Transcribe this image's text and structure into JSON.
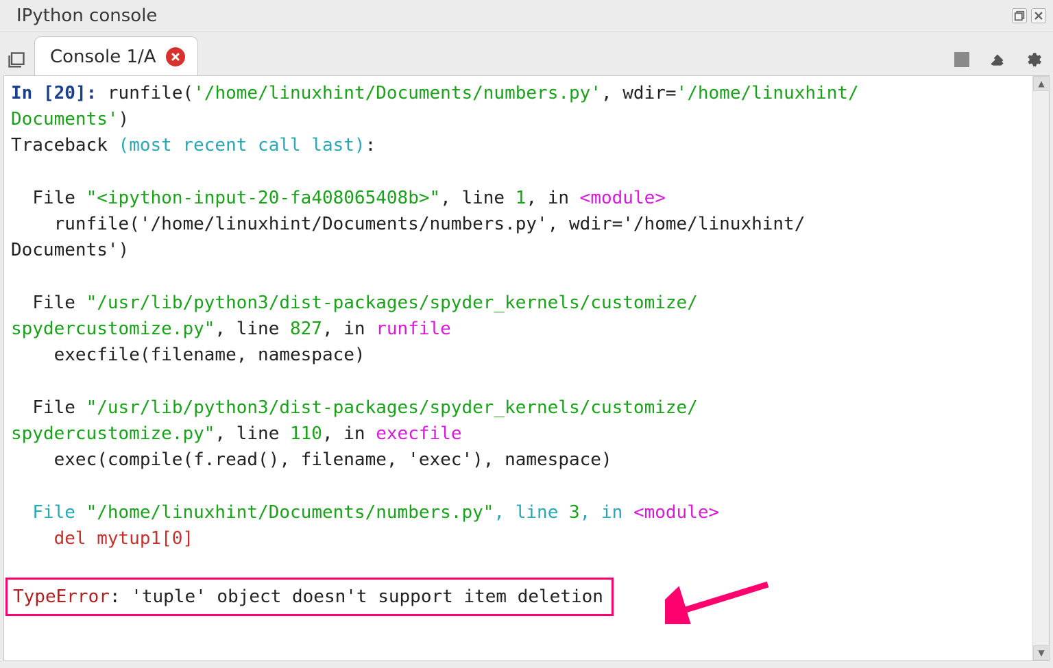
{
  "panel_title": "IPython console",
  "tab": {
    "label": "Console 1/A"
  },
  "prompt": {
    "label": "In",
    "count": "20"
  },
  "cmd": {
    "fn": "runfile",
    "arg_path": "'/home/linuxhint/Documents/numbers.py'",
    "arg_wdir_key": ", wdir=",
    "arg_wdir_val_a": "'/home/linuxhint/",
    "arg_wdir_val_b": "Documents'"
  },
  "tb_head": {
    "a": "Traceback ",
    "b": "(most recent call last)",
    "c": ":"
  },
  "frame1": {
    "file_kw": "File ",
    "path": "\"<ipython-input-20-fa408065408b>\"",
    "line_lbl": ", line ",
    "line_no": "1",
    "in_lbl": ", in ",
    "scope": "<module>",
    "code": "    runfile('/home/linuxhint/Documents/numbers.py', wdir='/home/linuxhint/\nDocuments')"
  },
  "frame2": {
    "file_kw": "File ",
    "path": "\"/usr/lib/python3/dist-packages/spyder_kernels/customize/\nspydercustomize.py\"",
    "line_lbl": ", line ",
    "line_no": "827",
    "in_lbl": ", in ",
    "scope": "runfile",
    "code": "    execfile(filename, namespace)"
  },
  "frame3": {
    "file_kw": "File ",
    "path": "\"/usr/lib/python3/dist-packages/spyder_kernels/customize/\nspydercustomize.py\"",
    "line_lbl": ", line ",
    "line_no": "110",
    "in_lbl": ", in ",
    "scope": "execfile",
    "code": "    exec(compile(f.read(), filename, 'exec'), namespace)"
  },
  "frame4": {
    "file_kw": "File ",
    "path": "\"/home/linuxhint/Documents/numbers.py\"",
    "line_lbl": ", line ",
    "line_no": "3",
    "in_lbl": ", in ",
    "scope": "<module>",
    "code": "    del mytup1[0]"
  },
  "error": {
    "type": "TypeError",
    "msg": ": 'tuple' object doesn't support item deletion"
  }
}
